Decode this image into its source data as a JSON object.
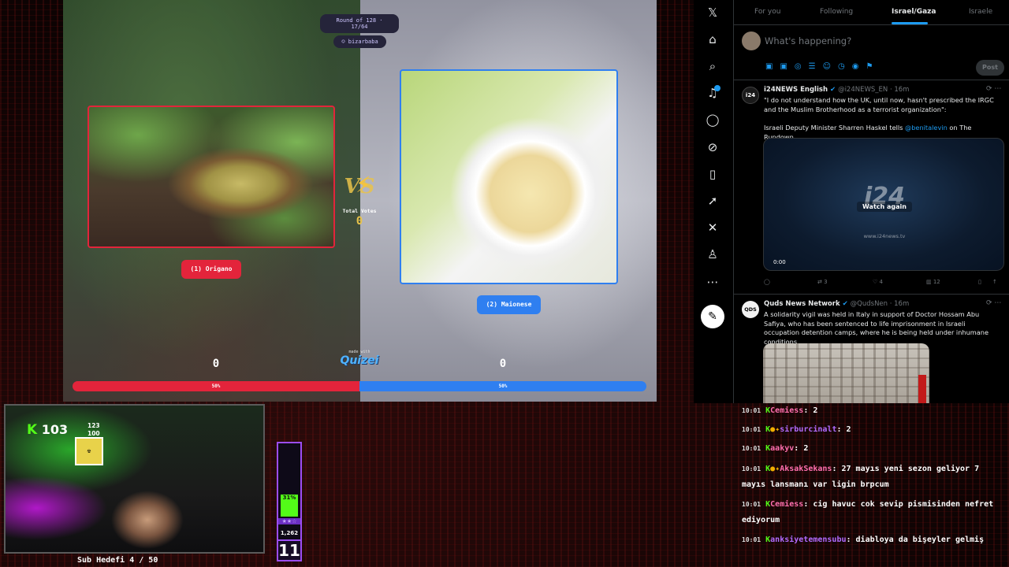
{
  "quiz": {
    "round": "Round of 128 · 17/64",
    "user": "bizarbaba",
    "vs": "VS",
    "total_votes_label": "Total Votes",
    "total_votes": "0",
    "option_left": "(1) Origano",
    "option_right": "(2) Maionese",
    "score_left": "0",
    "score_right": "0",
    "made_with": "made with",
    "logo": "Quizei",
    "pct_left": "50%",
    "pct_right": "50%",
    "accent_left": "#e3243b",
    "accent_right": "#2f7ff0"
  },
  "x_sidebar": {
    "icons": [
      "x-logo-icon",
      "home-icon",
      "search-icon",
      "bell-icon",
      "message-icon",
      "grok-icon",
      "bookmark-icon",
      "rocket-icon",
      "x-premium-icon",
      "profile-icon",
      "more-icon"
    ],
    "post_icon": "feather-icon"
  },
  "x_feed": {
    "tabs": [
      "For you",
      "Following",
      "Israel/Gaza",
      "Israele"
    ],
    "active_tab": "Israel/Gaza",
    "compose_placeholder": "What's happening?",
    "post_label": "Post",
    "tweets": [
      {
        "name": "i24NEWS English",
        "handle": "@i24NEWS_EN · 16m",
        "text_1": "\"I do not understand how the UK, until now, hasn't prescribed the IRGC and the Muslim Brotherhood as a terrorist organization\":",
        "text_2_before": "Israeli Deputy Minister Sharren Haskel tells ",
        "mention": "@benitalevin",
        "text_2_after": " on The Rundown",
        "video_logo": "i24",
        "video_overlay": "Watch again",
        "video_url": "www.i24news.tv",
        "video_time": "0:00",
        "replies": "",
        "reposts": "3",
        "likes": "4",
        "views": "12"
      },
      {
        "name": "Quds News Network",
        "handle": "@QudsNen · 16m",
        "text_1": "A solidarity vigil was held in Italy in support of Doctor Hossam Abu Safiya, who has been sentenced to life imprisonment in Israeli occupation detention camps, where he is being held under inhumane conditions."
      }
    ]
  },
  "webcam": {
    "followers": "103",
    "mini_top": "123",
    "mini_bottom": "100",
    "sub_goal": "Sub Hedefi 4 / 50"
  },
  "meter": {
    "percent": "31%",
    "fill_fraction": 0.31,
    "stars": "★★☆",
    "count": "1,262",
    "level": "11"
  },
  "chat": [
    {
      "time": "10:01",
      "user": "Cemiess",
      "msg": "2",
      "color": "#ff6fae"
    },
    {
      "time": "10:01",
      "user": "sirburcinalt",
      "msg": "2",
      "color": "#b06bff"
    },
    {
      "time": "10:01",
      "user": "aakyv",
      "msg": "2",
      "color": "#ff6fae"
    },
    {
      "time": "10:01",
      "user": "AksakSekans",
      "msg": "27 mayıs yeni sezon geliyor 7 mayıs lansmanı var ligin brpcum",
      "color": "#ff6fae"
    },
    {
      "time": "10:01",
      "user": "Cemiess",
      "msg": "cig havuc cok sevip pismisinden nefret ediyorum",
      "color": "#ff6fae"
    },
    {
      "time": "10:01",
      "user": "anksiyetemensubu",
      "msg": "diabloya da bişeyler gelmiş",
      "color": "#b06bff"
    }
  ]
}
